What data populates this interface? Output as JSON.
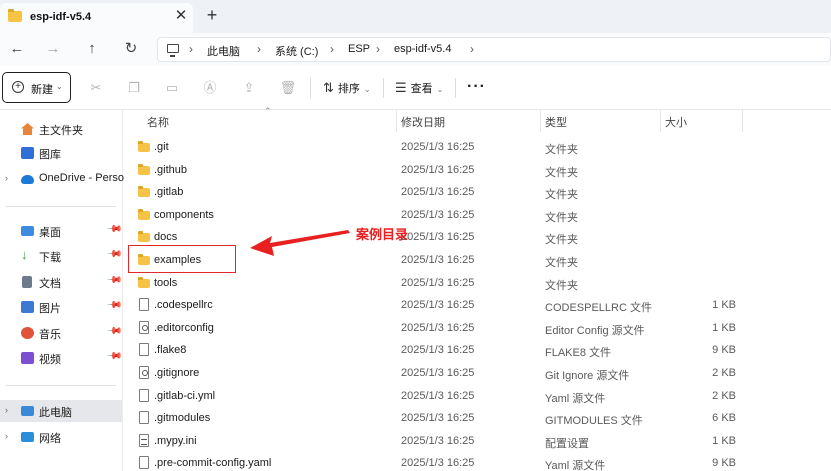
{
  "window": {
    "tab_title": "esp-idf-v5.4",
    "tab_close": "✕",
    "tab_add": "+"
  },
  "nav": {
    "back": "←",
    "forward": "→",
    "up": "↑",
    "refresh": "↻",
    "breadcrumbs": [
      "此电脑",
      "系统 (C:)",
      "ESP",
      "esp-idf-v5.4"
    ],
    "sep": "›"
  },
  "commandbar": {
    "new_label": "新建",
    "sort_label": "排序",
    "view_label": "查看",
    "more": "···"
  },
  "sidebar": {
    "items": [
      {
        "label": "主文件夹",
        "icon": "home-icon",
        "color": "#e6863a"
      },
      {
        "label": "图库",
        "icon": "gallery-icon",
        "color": "#2f6fd6"
      },
      {
        "label": "OneDrive - Perso",
        "icon": "cloud-icon",
        "color": "#1e7ad6"
      },
      {
        "label": "桌面",
        "icon": "desktop-icon",
        "color": "#3d8be0"
      },
      {
        "label": "下载",
        "icon": "download-icon",
        "color": "#2b9c59"
      },
      {
        "label": "文档",
        "icon": "document-icon",
        "color": "#6d7a8c"
      },
      {
        "label": "图片",
        "icon": "pictures-icon",
        "color": "#3b79d4"
      },
      {
        "label": "音乐",
        "icon": "music-icon",
        "color": "#e2513a"
      },
      {
        "label": "视频",
        "icon": "video-icon",
        "color": "#7c4fd1"
      },
      {
        "label": "此电脑",
        "icon": "computer-icon",
        "color": "#3a89d8"
      },
      {
        "label": "网络",
        "icon": "network-icon",
        "color": "#2a8fd8"
      }
    ]
  },
  "columns": {
    "name": "名称",
    "date": "修改日期",
    "type": "类型",
    "size": "大小"
  },
  "files": [
    {
      "name": ".git",
      "date": "2025/1/3 16:25",
      "type": "文件夹",
      "size": ""
    },
    {
      "name": ".github",
      "date": "2025/1/3 16:25",
      "type": "文件夹",
      "size": ""
    },
    {
      "name": ".gitlab",
      "date": "2025/1/3 16:25",
      "type": "文件夹",
      "size": ""
    },
    {
      "name": "components",
      "date": "2025/1/3 16:25",
      "type": "文件夹",
      "size": ""
    },
    {
      "name": "docs",
      "date": "2025/1/3 16:25",
      "type": "文件夹",
      "size": ""
    },
    {
      "name": "examples",
      "date": "2025/1/3 16:25",
      "type": "文件夹",
      "size": ""
    },
    {
      "name": "tools",
      "date": "2025/1/3 16:25",
      "type": "文件夹",
      "size": ""
    },
    {
      "name": ".codespellrc",
      "date": "2025/1/3 16:25",
      "type": "CODESPELLRC 文件",
      "size": "1 KB"
    },
    {
      "name": ".editorconfig",
      "date": "2025/1/3 16:25",
      "type": "Editor Config 源文件",
      "size": "1 KB"
    },
    {
      "name": ".flake8",
      "date": "2025/1/3 16:25",
      "type": "FLAKE8 文件",
      "size": "9 KB"
    },
    {
      "name": ".gitignore",
      "date": "2025/1/3 16:25",
      "type": "Git Ignore 源文件",
      "size": "2 KB"
    },
    {
      "name": ".gitlab-ci.yml",
      "date": "2025/1/3 16:25",
      "type": "Yaml 源文件",
      "size": "2 KB"
    },
    {
      "name": ".gitmodules",
      "date": "2025/1/3 16:25",
      "type": "GITMODULES 文件",
      "size": "6 KB"
    },
    {
      "name": ".mypy.ini",
      "date": "2025/1/3 16:25",
      "type": "配置设置",
      "size": "1 KB"
    },
    {
      "name": ".pre-commit-config.yaml",
      "date": "2025/1/3 16:25",
      "type": "Yaml 源文件",
      "size": "9 KB"
    }
  ],
  "annotation": {
    "text": "案例目录",
    "color": "#e82020"
  }
}
